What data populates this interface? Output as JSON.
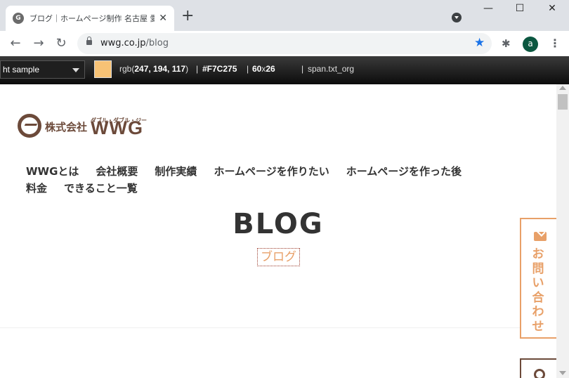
{
  "browser": {
    "tab_title": "ブログ｜ホームページ制作 名古屋 愛知",
    "tab_favicon": "wwg-logo",
    "url_host": "wwg.co.jp",
    "url_path": "/blog",
    "profile_initial": "a",
    "accent_color": "#1a73e8"
  },
  "picker": {
    "select_value": "ht sample",
    "swatch_color": "#f7c275",
    "rgb_prefix": "rgb(",
    "rgb_values": "247, 194, 117",
    "rgb_suffix": ")",
    "hex": "#F7C275",
    "size_w": "60",
    "size_x": "x",
    "size_h": "26",
    "selector": "span.txt_org"
  },
  "site": {
    "logo_company": "株式会社",
    "logo_name": "WWG",
    "logo_ruby": "ダブル・ダブル・ジー",
    "brand_color": "#6c4a3a",
    "nav": [
      "WWGとは",
      "会社概要",
      "制作実績",
      "ホームページを作りたい",
      "ホームページを作った後",
      "料金",
      "できること一覧"
    ],
    "page_title": "BLOG",
    "page_subtitle": "ブログ",
    "subtitle_color": "#e8a068",
    "contact_text": "お問い合わせ"
  }
}
